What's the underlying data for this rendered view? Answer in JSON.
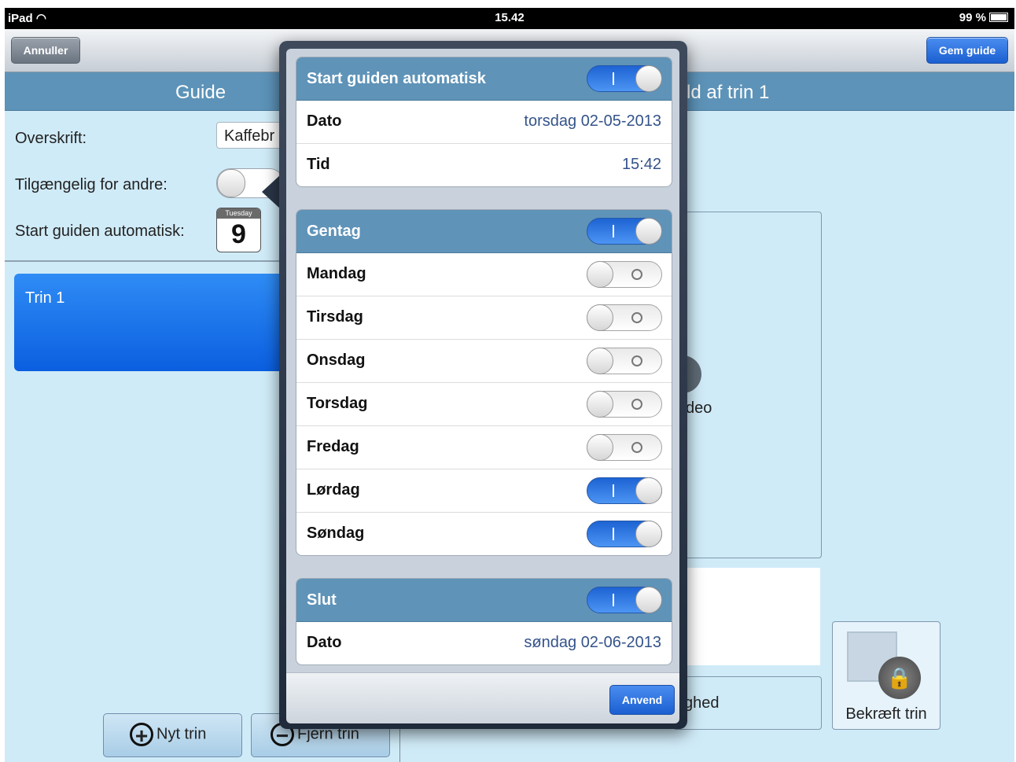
{
  "status_bar": {
    "device": "iPad",
    "time": "15.42",
    "battery": "99 %"
  },
  "nav": {
    "cancel": "Annuller",
    "save": "Gem guide"
  },
  "left": {
    "title": "Guide",
    "heading_label": "Overskrift:",
    "heading_value": "Kaffebr",
    "share_label": "Tilgængelig for andre:",
    "autostart_label": "Start guiden automatisk:",
    "calendar_day": "Tuesday",
    "calendar_date": "9",
    "step_name": "Trin 1",
    "new_step": "Nyt trin",
    "remove_step": "Fjern trin"
  },
  "right": {
    "title_partial": "ld af trin 1",
    "video_partial": "deo",
    "input_partial": "ghed",
    "confirm_step": "Bekræft trin"
  },
  "popover": {
    "start": {
      "title": "Start guiden automatisk",
      "enabled": true,
      "date_label": "Dato",
      "date_value": "torsdag 02-05-2013",
      "time_label": "Tid",
      "time_value": "15:42"
    },
    "repeat": {
      "title": "Gentag",
      "enabled": true,
      "days": [
        {
          "label": "Mandag",
          "on": false
        },
        {
          "label": "Tirsdag",
          "on": false
        },
        {
          "label": "Onsdag",
          "on": false
        },
        {
          "label": "Torsdag",
          "on": false
        },
        {
          "label": "Fredag",
          "on": false
        },
        {
          "label": "Lørdag",
          "on": true
        },
        {
          "label": "Søndag",
          "on": true
        }
      ]
    },
    "end": {
      "title": "Slut",
      "enabled": true,
      "date_label": "Dato",
      "date_value": "søndag 02-06-2013"
    },
    "apply": "Anvend"
  }
}
